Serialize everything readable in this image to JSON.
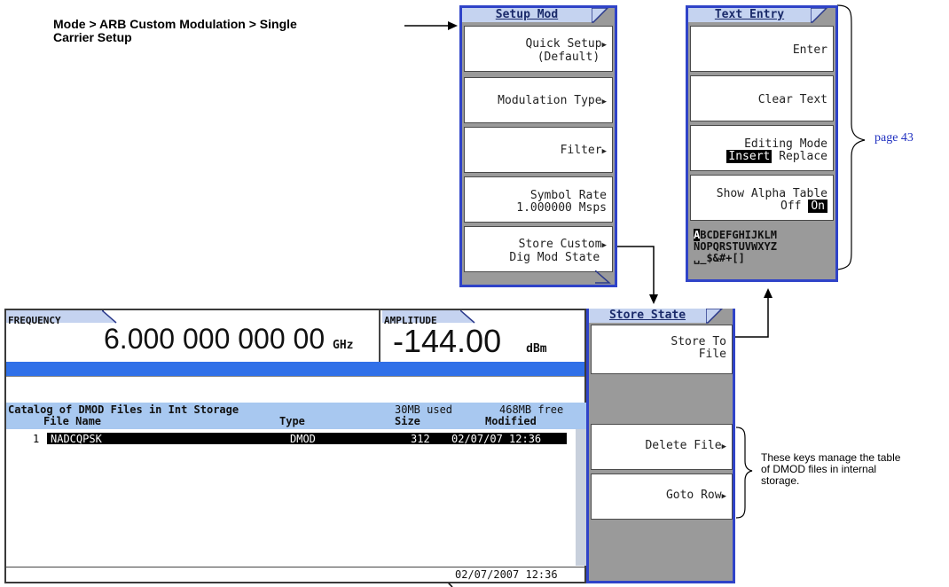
{
  "callout_mode": "Mode > ARB Custom Modulation > Single Carrier Setup",
  "callout_mode_line1": "Mode > ARB Custom Modulation > Single",
  "callout_mode_line2": "Carrier Setup",
  "setup_mod": {
    "title": "Setup Mod",
    "keys": [
      {
        "line1": "Quick Setup",
        "line2": "(Default)"
      },
      {
        "line1": "Modulation Type",
        "line2": ""
      },
      {
        "line1": "Filter",
        "line2": ""
      },
      {
        "line1": "Symbol Rate",
        "line2": "1.000000 Msps"
      },
      {
        "line1": "Store Custom",
        "line2": "Dig Mod State"
      }
    ]
  },
  "text_entry": {
    "title": "Text Entry",
    "enter": "Enter",
    "clear": "Clear Text",
    "editing_mode": "Editing Mode",
    "insert": "Insert",
    "replace": "Replace",
    "show_alpha": "Show Alpha Table",
    "off": "Off",
    "on": "On",
    "alpha_row1_sel": "A",
    "alpha_row1": "BCDEFGHIJKLM",
    "alpha_row2": "NOPQRSTUVWXYZ",
    "alpha_row3": "␣_$&#+[]"
  },
  "page_ref": "page 43",
  "screen": {
    "frequency_label": "FREQUENCY",
    "frequency_value": "6.000 000 000 00",
    "frequency_unit": "GHz",
    "amplitude_label": "AMPLITUDE",
    "amplitude_value": "-144.00",
    "amplitude_unit": "dBm",
    "catalog_title": "Catalog of DMOD Files in Int Storage",
    "used": "30MB used",
    "free": "468MB free",
    "col_name": "File Name",
    "col_type": "Type",
    "col_size": "Size",
    "col_modified": "Modified",
    "rows": [
      {
        "num": "1",
        "name": "NADCQPSK",
        "type": "DMOD",
        "size": "312",
        "modified": "02/07/07 12:36"
      }
    ],
    "status_datetime": "02/07/2007 12:36"
  },
  "store_state": {
    "title": "Store State",
    "store_line1": "Store To",
    "store_line2": "File",
    "delete": "Delete File",
    "goto": "Goto Row"
  },
  "callout_keys_line1": "These keys manage the table",
  "callout_keys_line2": "of DMOD files in internal",
  "callout_keys_line3": "storage."
}
